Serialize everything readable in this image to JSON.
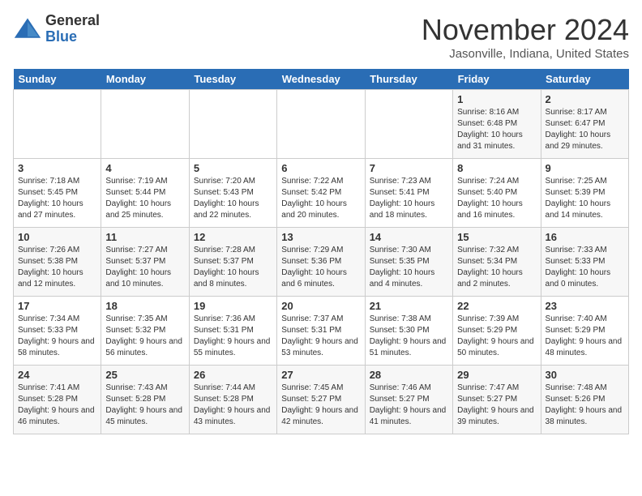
{
  "logo": {
    "general": "General",
    "blue": "Blue"
  },
  "title": "November 2024",
  "location": "Jasonville, Indiana, United States",
  "days_of_week": [
    "Sunday",
    "Monday",
    "Tuesday",
    "Wednesday",
    "Thursday",
    "Friday",
    "Saturday"
  ],
  "weeks": [
    [
      {
        "day": "",
        "info": ""
      },
      {
        "day": "",
        "info": ""
      },
      {
        "day": "",
        "info": ""
      },
      {
        "day": "",
        "info": ""
      },
      {
        "day": "",
        "info": ""
      },
      {
        "day": "1",
        "info": "Sunrise: 8:16 AM\nSunset: 6:48 PM\nDaylight: 10 hours and 31 minutes."
      },
      {
        "day": "2",
        "info": "Sunrise: 8:17 AM\nSunset: 6:47 PM\nDaylight: 10 hours and 29 minutes."
      }
    ],
    [
      {
        "day": "3",
        "info": "Sunrise: 7:18 AM\nSunset: 5:45 PM\nDaylight: 10 hours and 27 minutes."
      },
      {
        "day": "4",
        "info": "Sunrise: 7:19 AM\nSunset: 5:44 PM\nDaylight: 10 hours and 25 minutes."
      },
      {
        "day": "5",
        "info": "Sunrise: 7:20 AM\nSunset: 5:43 PM\nDaylight: 10 hours and 22 minutes."
      },
      {
        "day": "6",
        "info": "Sunrise: 7:22 AM\nSunset: 5:42 PM\nDaylight: 10 hours and 20 minutes."
      },
      {
        "day": "7",
        "info": "Sunrise: 7:23 AM\nSunset: 5:41 PM\nDaylight: 10 hours and 18 minutes."
      },
      {
        "day": "8",
        "info": "Sunrise: 7:24 AM\nSunset: 5:40 PM\nDaylight: 10 hours and 16 minutes."
      },
      {
        "day": "9",
        "info": "Sunrise: 7:25 AM\nSunset: 5:39 PM\nDaylight: 10 hours and 14 minutes."
      }
    ],
    [
      {
        "day": "10",
        "info": "Sunrise: 7:26 AM\nSunset: 5:38 PM\nDaylight: 10 hours and 12 minutes."
      },
      {
        "day": "11",
        "info": "Sunrise: 7:27 AM\nSunset: 5:37 PM\nDaylight: 10 hours and 10 minutes."
      },
      {
        "day": "12",
        "info": "Sunrise: 7:28 AM\nSunset: 5:37 PM\nDaylight: 10 hours and 8 minutes."
      },
      {
        "day": "13",
        "info": "Sunrise: 7:29 AM\nSunset: 5:36 PM\nDaylight: 10 hours and 6 minutes."
      },
      {
        "day": "14",
        "info": "Sunrise: 7:30 AM\nSunset: 5:35 PM\nDaylight: 10 hours and 4 minutes."
      },
      {
        "day": "15",
        "info": "Sunrise: 7:32 AM\nSunset: 5:34 PM\nDaylight: 10 hours and 2 minutes."
      },
      {
        "day": "16",
        "info": "Sunrise: 7:33 AM\nSunset: 5:33 PM\nDaylight: 10 hours and 0 minutes."
      }
    ],
    [
      {
        "day": "17",
        "info": "Sunrise: 7:34 AM\nSunset: 5:33 PM\nDaylight: 9 hours and 58 minutes."
      },
      {
        "day": "18",
        "info": "Sunrise: 7:35 AM\nSunset: 5:32 PM\nDaylight: 9 hours and 56 minutes."
      },
      {
        "day": "19",
        "info": "Sunrise: 7:36 AM\nSunset: 5:31 PM\nDaylight: 9 hours and 55 minutes."
      },
      {
        "day": "20",
        "info": "Sunrise: 7:37 AM\nSunset: 5:31 PM\nDaylight: 9 hours and 53 minutes."
      },
      {
        "day": "21",
        "info": "Sunrise: 7:38 AM\nSunset: 5:30 PM\nDaylight: 9 hours and 51 minutes."
      },
      {
        "day": "22",
        "info": "Sunrise: 7:39 AM\nSunset: 5:29 PM\nDaylight: 9 hours and 50 minutes."
      },
      {
        "day": "23",
        "info": "Sunrise: 7:40 AM\nSunset: 5:29 PM\nDaylight: 9 hours and 48 minutes."
      }
    ],
    [
      {
        "day": "24",
        "info": "Sunrise: 7:41 AM\nSunset: 5:28 PM\nDaylight: 9 hours and 46 minutes."
      },
      {
        "day": "25",
        "info": "Sunrise: 7:43 AM\nSunset: 5:28 PM\nDaylight: 9 hours and 45 minutes."
      },
      {
        "day": "26",
        "info": "Sunrise: 7:44 AM\nSunset: 5:28 PM\nDaylight: 9 hours and 43 minutes."
      },
      {
        "day": "27",
        "info": "Sunrise: 7:45 AM\nSunset: 5:27 PM\nDaylight: 9 hours and 42 minutes."
      },
      {
        "day": "28",
        "info": "Sunrise: 7:46 AM\nSunset: 5:27 PM\nDaylight: 9 hours and 41 minutes."
      },
      {
        "day": "29",
        "info": "Sunrise: 7:47 AM\nSunset: 5:27 PM\nDaylight: 9 hours and 39 minutes."
      },
      {
        "day": "30",
        "info": "Sunrise: 7:48 AM\nSunset: 5:26 PM\nDaylight: 9 hours and 38 minutes."
      }
    ]
  ]
}
